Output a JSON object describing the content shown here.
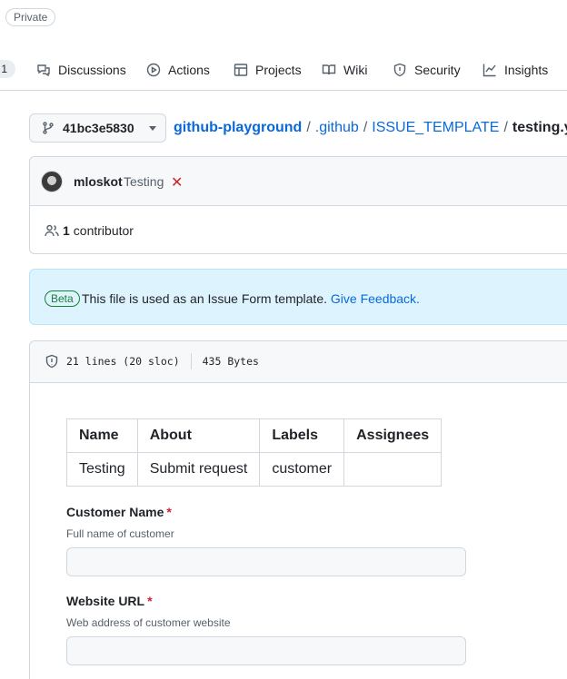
{
  "repo_header": {
    "visibility_badge": "Private"
  },
  "nav": {
    "truncated_counter": "1",
    "items": [
      {
        "label": "Discussions",
        "icon": "discussions-icon"
      },
      {
        "label": "Actions",
        "icon": "play-icon"
      },
      {
        "label": "Projects",
        "icon": "table-icon"
      },
      {
        "label": "Wiki",
        "icon": "book-icon"
      },
      {
        "label": "Security",
        "icon": "shield-icon"
      },
      {
        "label": "Insights",
        "icon": "graph-icon"
      }
    ]
  },
  "branch_selector": {
    "label": "41bc3e5830",
    "icon": "git-branch-icon"
  },
  "breadcrumb": {
    "repo": "github-playground",
    "dir1": ".github",
    "dir2": "ISSUE_TEMPLATE",
    "file": "testing.yml",
    "separator": "/"
  },
  "commit": {
    "author": "mloskot",
    "message": "Testing",
    "status_symbol": "✕",
    "contributors_count": "1",
    "contributors_label": "contributor"
  },
  "flash": {
    "badge": "Beta",
    "text": "This file is used as an Issue Form template.",
    "link": "Give Feedback."
  },
  "file_info": {
    "lines": "21 lines (20 sloc)",
    "size": "435 Bytes"
  },
  "template_table": {
    "headers": [
      "Name",
      "About",
      "Labels",
      "Assignees"
    ],
    "row": [
      "Testing",
      "Submit request",
      "customer",
      ""
    ]
  },
  "form_fields": [
    {
      "label": "Customer Name",
      "required_mark": "*",
      "description": "Full name of customer"
    },
    {
      "label": "Website URL",
      "required_mark": "*",
      "description": "Web address of customer website"
    }
  ],
  "colors": {
    "link": "#0969da",
    "danger": "#cf222e",
    "success": "#1a7f37",
    "flash_bg": "#ddf4ff"
  }
}
